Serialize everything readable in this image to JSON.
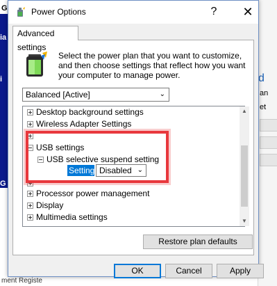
{
  "background": {
    "left_letters": [
      "G",
      "ia",
      "i",
      "G"
    ],
    "right_snippets": [
      "d",
      "an",
      "et"
    ],
    "bottom_text": "ment Registe"
  },
  "window": {
    "title": "Power Options",
    "help_label": "?",
    "close_label": "✕",
    "icon": "power-options-icon"
  },
  "tab": {
    "label": "Advanced settings"
  },
  "intro": {
    "text": "Select the power plan that you want to customize, and then choose settings that reflect how you want your computer to manage power.",
    "icon": "battery-plan-icon"
  },
  "plan_select": {
    "value": "Balanced [Active]"
  },
  "tree": {
    "items": [
      {
        "label": "Desktop background settings",
        "expanded": false
      },
      {
        "label": "Wireless Adapter Settings",
        "expanded": false
      },
      {
        "label": "USB settings",
        "expanded": true
      },
      {
        "label": "USB selective suspend setting",
        "expanded": true
      },
      {
        "label": "Processor power management",
        "expanded": false
      },
      {
        "label": "Display",
        "expanded": false
      },
      {
        "label": "Multimedia settings",
        "expanded": false
      }
    ],
    "setting": {
      "label": "Setting:",
      "value": "Disabled"
    }
  },
  "buttons": {
    "restore": "Restore plan defaults",
    "ok": "OK",
    "cancel": "Cancel",
    "apply": "Apply"
  },
  "colors": {
    "highlight": "#e8383d",
    "selection": "#0078d7",
    "desktop_blue": "#0a1a8c"
  }
}
